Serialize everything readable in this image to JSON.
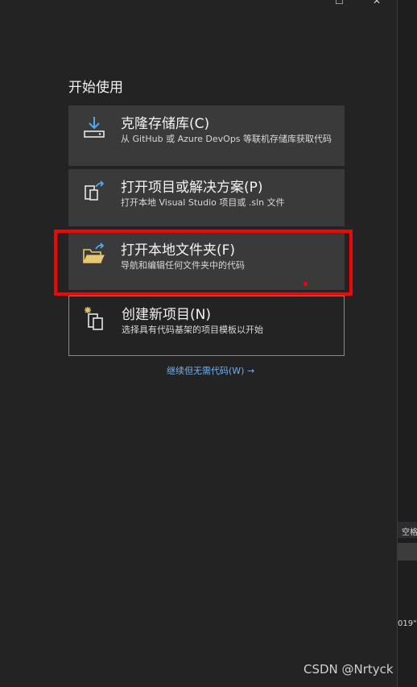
{
  "window_controls": {
    "restore": "☐",
    "close": "✕"
  },
  "section_title": "开始使用",
  "cards": [
    {
      "title": "克隆存储库(C)",
      "description": "从 GitHub 或 Azure DevOps 等联机存储库获取代码",
      "icon": "clone-download-icon"
    },
    {
      "title": "打开项目或解决方案(P)",
      "description": "打开本地 Visual Studio 项目或 .sln 文件",
      "icon": "open-project-icon"
    },
    {
      "title": "打开本地文件夹(F)",
      "description": "导航和编辑任何文件夹中的代码",
      "icon": "open-folder-icon"
    },
    {
      "title": "创建新项目(N)",
      "description": "选择具有代码基架的项目模板以开始",
      "icon": "new-project-icon"
    }
  ],
  "continue_link": "继续但无需代码(W) →",
  "right_strip": {
    "label_top": "空格",
    "label_bottom": "019\""
  },
  "watermark": "CSDN @Nrtyck",
  "colors": {
    "accent_link": "#6fb4f0",
    "highlight": "#ff0000",
    "folder": "#e8c86e",
    "icon_blue": "#4fa8f0"
  }
}
